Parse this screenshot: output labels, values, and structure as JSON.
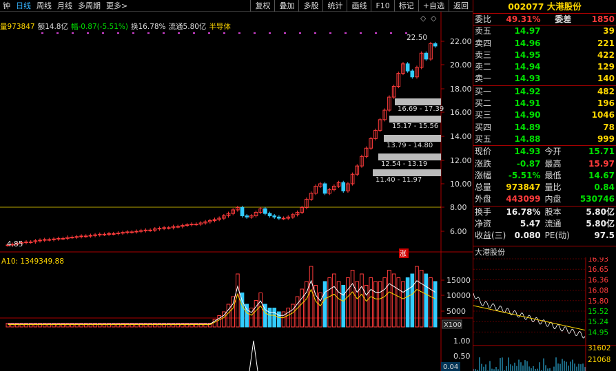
{
  "toolbar": {
    "left": [
      {
        "label": "钟",
        "active": false
      },
      {
        "label": "日线",
        "active": true
      },
      {
        "label": "周线",
        "active": false
      },
      {
        "label": "月线",
        "active": false
      },
      {
        "label": "多周期",
        "active": false
      },
      {
        "label": "更多>",
        "active": false
      }
    ],
    "right": [
      "复权",
      "叠加",
      "多股",
      "统计",
      "画线",
      "F10",
      "标记",
      "+自选",
      "返回"
    ]
  },
  "legend": {
    "volume": "量973847",
    "amount": "额14.8亿",
    "change": "幅-0.87(-5.51%)",
    "turnover": "换16.78%",
    "float": "流通5.80亿",
    "sector": "半导体"
  },
  "price_chart": {
    "y_ticks": [
      "22.00",
      "20.00",
      "18.00",
      "16.00",
      "14.00",
      "12.00",
      "10.00",
      "8.00",
      "6.00"
    ],
    "high_label": "22.50",
    "low_label": "4.85",
    "ranges": [
      "16.69 - 17.39",
      "15.17 - 15.56",
      "13.79 - 14.80",
      "12.54 - 13.19",
      "11.40 - 11.97"
    ],
    "up_marker": "涨"
  },
  "volume_chart": {
    "label": "A10: 1349349.88",
    "y_ticks": [
      "15000",
      "10000",
      "5000"
    ],
    "unit": "X100"
  },
  "indicator": {
    "y_ticks": [
      "1.00",
      "0.50"
    ],
    "value": "0.04"
  },
  "right_panel": {
    "title": "002077 大港股份",
    "header": {
      "label1": "委比",
      "val1": "49.31%",
      "label2": "委差",
      "val2": "1850"
    },
    "asks": [
      {
        "label": "卖五",
        "price": "14.97",
        "vol": "39"
      },
      {
        "label": "卖四",
        "price": "14.96",
        "vol": "221"
      },
      {
        "label": "卖三",
        "price": "14.95",
        "vol": "422"
      },
      {
        "label": "卖二",
        "price": "14.94",
        "vol": "129"
      },
      {
        "label": "卖一",
        "price": "14.93",
        "vol": "140"
      }
    ],
    "bids": [
      {
        "label": "买一",
        "price": "14.92",
        "vol": "482"
      },
      {
        "label": "买二",
        "price": "14.91",
        "vol": "196"
      },
      {
        "label": "买三",
        "price": "14.90",
        "vol": "1046"
      },
      {
        "label": "买四",
        "price": "14.89",
        "vol": "78"
      },
      {
        "label": "买五",
        "price": "14.88",
        "vol": "999"
      }
    ],
    "stats": [
      {
        "l1": "现价",
        "v1": "14.93",
        "l2": "今开",
        "v2": "15.71",
        "c1": "green",
        "c2": "green"
      },
      {
        "l1": "涨跌",
        "v1": "-0.87",
        "l2": "最高",
        "v2": "15.97",
        "c1": "green",
        "c2": "red"
      },
      {
        "l1": "涨幅",
        "v1": "-5.51%",
        "l2": "最低",
        "v2": "14.67",
        "c1": "green",
        "c2": "green"
      },
      {
        "l1": "总量",
        "v1": "973847",
        "l2": "量比",
        "v2": "0.84",
        "c1": "yellow",
        "c2": "green"
      },
      {
        "l1": "外盘",
        "v1": "443099",
        "l2": "内盘",
        "v2": "530746",
        "c1": "red",
        "c2": "green"
      }
    ],
    "stats2": [
      {
        "l1": "换手",
        "v1": "16.78%",
        "l2": "股本",
        "v2": "5.80亿"
      },
      {
        "l1": "净资",
        "v1": "5.47",
        "l2": "流通",
        "v2": "5.80亿"
      },
      {
        "l1": "收益(三)",
        "v1": "0.080",
        "l2": "PE(动)",
        "v2": "97.5"
      }
    ],
    "mini_title": "大港股份",
    "mini_ticks": [
      "16.93",
      "16.65",
      "16.36",
      "16.08",
      "15.80",
      "15.52",
      "15.24",
      "14.95"
    ],
    "mini_vol": [
      "31602",
      "21068"
    ]
  },
  "colors": {
    "up": "#ff3b3b",
    "down": "#3cf",
    "grid": "#8b0000",
    "ma": "#ffd700"
  }
}
